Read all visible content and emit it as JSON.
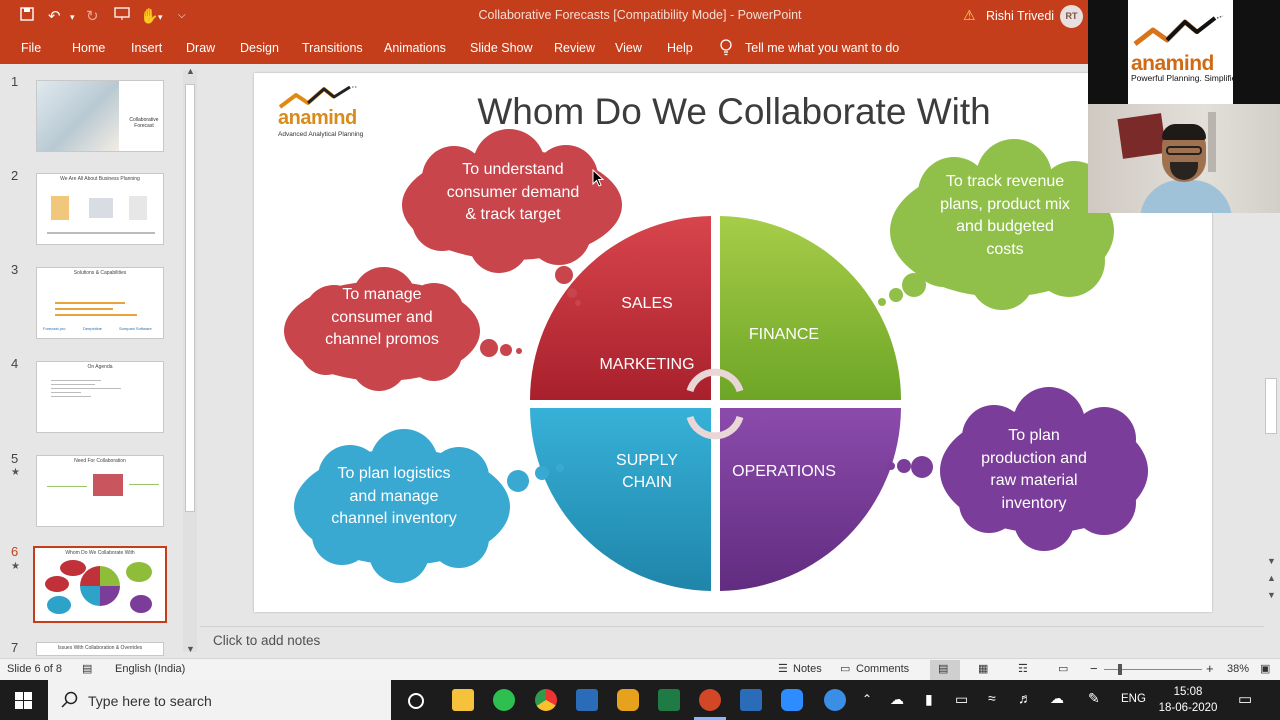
{
  "window": {
    "title": "Collaborative Forecasts [Compatibility Mode] - PowerPoint",
    "user_name": "Rishi Trivedi",
    "user_initials": "RT"
  },
  "ribbon": {
    "tabs": [
      "File",
      "Home",
      "Insert",
      "Draw",
      "Design",
      "Transitions",
      "Animations",
      "Slide Show",
      "Review",
      "View",
      "Help"
    ],
    "tell_me": "Tell me what you want to do"
  },
  "thumbnails": [
    {
      "number": "1",
      "title": "Collaborative Forecast",
      "starred": false
    },
    {
      "number": "2",
      "title": "We Are All About Business Planning",
      "starred": false
    },
    {
      "number": "3",
      "title": "Solutions & Capabilities",
      "starred": false
    },
    {
      "number": "4",
      "title": "On Agenda",
      "starred": false
    },
    {
      "number": "5",
      "title": "Need For Collaboration",
      "starred": true
    },
    {
      "number": "6",
      "title": "Whom Do We Collaborate With",
      "starred": true
    },
    {
      "number": "7",
      "title": "Issues With Collaboration & Overrides",
      "starred": false
    }
  ],
  "thumb3_logos": [
    "Forecast pro",
    "Deepinline",
    "Sompani Software"
  ],
  "slide": {
    "title": "Whom Do We Collaborate With",
    "logo_word": "anamind",
    "logo_tagline": "Advanced Analytical Planning",
    "quadrants": {
      "sales": "SALES",
      "marketing": "MARKETING",
      "finance": "FINANCE",
      "supply_chain": "SUPPLY CHAIN",
      "operations": "OPERATIONS"
    },
    "clouds": {
      "sales": "To understand consumer demand & track target",
      "marketing": "To manage consumer and channel promos",
      "finance": "To track revenue plans, product mix and budgeted costs",
      "supply_chain": "To plan logistics and manage channel inventory",
      "operations": "To plan production and raw material inventory"
    },
    "colors": {
      "sales": "#c0313a",
      "finance": "#8fbd3a",
      "supply_chain": "#2ea3c9",
      "operations": "#7a3d99"
    }
  },
  "overlay": {
    "logo_word": "anamind",
    "logo_tagline": "Powerful Planning. Simplified"
  },
  "notes": {
    "placeholder": "Click to add notes"
  },
  "status": {
    "slide_counter": "Slide 6 of 8",
    "language": "English (India)",
    "notes_label": "Notes",
    "comments_label": "Comments",
    "zoom": "38%"
  },
  "taskbar": {
    "search_placeholder": "Type here to search",
    "language": "ENG",
    "time": "15:08",
    "date": "18-06-2020"
  }
}
